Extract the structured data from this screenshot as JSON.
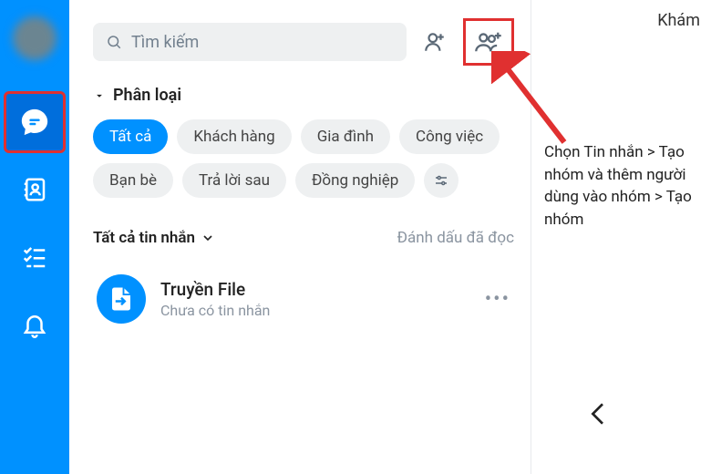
{
  "sidebar": {
    "items": [
      "avatar",
      "messages",
      "contacts",
      "todo",
      "notifications"
    ]
  },
  "search": {
    "placeholder": "Tìm kiếm"
  },
  "category": {
    "label": "Phân loại"
  },
  "chips": {
    "all": "Tất cả",
    "customers": "Khách hàng",
    "family": "Gia đình",
    "work": "Công việc",
    "friends": "Bạn bè",
    "reply_later": "Trả lời sau",
    "colleagues": "Đồng nghiệp"
  },
  "filter": {
    "all_messages": "Tất cả tin nhắn",
    "mark_read": "Đánh dấu đã đọc"
  },
  "conversations": [
    {
      "title": "Truyền File",
      "subtitle": "Chưa có tin nhắn"
    }
  ],
  "right": {
    "kham": "Khám",
    "instruction": "Chọn Tin nhắn > Tạo nhóm và thêm người dùng vào nhóm > Tạo nhóm"
  }
}
